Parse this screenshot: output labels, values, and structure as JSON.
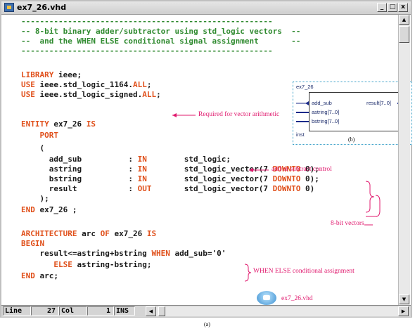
{
  "window": {
    "title": "ex7_26.vhd",
    "controls": [
      "_",
      "□",
      "x"
    ]
  },
  "code_lines": [
    {
      "t": [
        [
          "c",
          "------------------------------------------------------"
        ]
      ]
    },
    {
      "t": [
        [
          "c",
          "-- 8-bit binary adder/subtractor using std_logic vectors  --"
        ]
      ]
    },
    {
      "t": [
        [
          "c",
          "--  and the WHEN ELSE conditional signal assignment       --"
        ]
      ]
    },
    {
      "t": [
        [
          "c",
          "------------------------------------------------------"
        ]
      ]
    },
    {
      "t": []
    },
    {
      "t": [
        [
          "k",
          "LIBRARY"
        ],
        [
          "n",
          " ieee;"
        ]
      ]
    },
    {
      "t": [
        [
          "k",
          "USE"
        ],
        [
          "n",
          " ieee.std_logic_1164."
        ],
        [
          "k",
          "ALL"
        ],
        [
          "n",
          ";"
        ]
      ]
    },
    {
      "t": [
        [
          "k",
          "USE"
        ],
        [
          "n",
          " ieee.std_logic_signed."
        ],
        [
          "k",
          "ALL"
        ],
        [
          "n",
          ";"
        ]
      ]
    },
    {
      "t": []
    },
    {
      "t": [
        [
          "k",
          "ENTITY"
        ],
        [
          "n",
          " ex7_26 "
        ],
        [
          "k",
          "IS"
        ]
      ]
    },
    {
      "t": [
        [
          "n",
          "    "
        ],
        [
          "k",
          "PORT"
        ]
      ]
    },
    {
      "t": [
        [
          "n",
          "    ("
        ]
      ]
    },
    {
      "t": [
        [
          "n",
          "      add_sub          : "
        ],
        [
          "k",
          "IN"
        ],
        [
          "n",
          "        std_logic;"
        ]
      ]
    },
    {
      "t": [
        [
          "n",
          "      astring          : "
        ],
        [
          "k",
          "IN"
        ],
        [
          "n",
          "        std_logic_vector(7 "
        ],
        [
          "k",
          "DOWNTO"
        ],
        [
          "n",
          " 0);"
        ]
      ]
    },
    {
      "t": [
        [
          "n",
          "      bstring          : "
        ],
        [
          "k",
          "IN"
        ],
        [
          "n",
          "        std_logic_vector(7 "
        ],
        [
          "k",
          "DOWNTO"
        ],
        [
          "n",
          " 0);"
        ]
      ]
    },
    {
      "t": [
        [
          "n",
          "      result           : "
        ],
        [
          "k",
          "OUT"
        ],
        [
          "n",
          "       std_logic_vector(7 "
        ],
        [
          "k",
          "DOWNTO"
        ],
        [
          "n",
          " 0)"
        ]
      ]
    },
    {
      "t": [
        [
          "n",
          "    );"
        ]
      ]
    },
    {
      "t": [
        [
          "k",
          "END"
        ],
        [
          "n",
          " ex7_26 ;"
        ]
      ]
    },
    {
      "t": []
    },
    {
      "t": [
        [
          "k",
          "ARCHITECTURE"
        ],
        [
          "n",
          " arc "
        ],
        [
          "k",
          "OF"
        ],
        [
          "n",
          " ex7_26 "
        ],
        [
          "k",
          "IS"
        ]
      ]
    },
    {
      "t": [
        [
          "k",
          "BEGIN"
        ]
      ]
    },
    {
      "t": [
        [
          "n",
          "    result<=astring+bstring "
        ],
        [
          "k",
          "WHEN"
        ],
        [
          "n",
          " add_sub='0'"
        ]
      ]
    },
    {
      "t": [
        [
          "n",
          "       "
        ],
        [
          "k",
          "ELSE"
        ],
        [
          "n",
          " astring-bstring;"
        ]
      ]
    },
    {
      "t": [
        [
          "k",
          "END"
        ],
        [
          "n",
          " arc;"
        ]
      ]
    }
  ],
  "annotations": {
    "vector_arith": "Required for vector arithmetic",
    "add_sub_ctrl": "add or subtract control",
    "vectors": "8-bit vectors",
    "when_else": "WHEN ELSE  conditional assignment",
    "file_name": "ex7_26.vhd"
  },
  "block": {
    "name": "ex7_26",
    "inputs": [
      "add_sub",
      "astring[7..0]",
      "bstring[7..0]"
    ],
    "output": "result[7..0]",
    "inst": "inst",
    "caption": "(b)"
  },
  "status": {
    "line_label": "Line",
    "line_value": "27",
    "col_label": "Col",
    "col_value": "1",
    "mode": "INS"
  },
  "caption_a": "(a)",
  "colors": {
    "comment": "#2f8a2f",
    "keyword": "#e0501b",
    "annotation": "#e0186d"
  }
}
